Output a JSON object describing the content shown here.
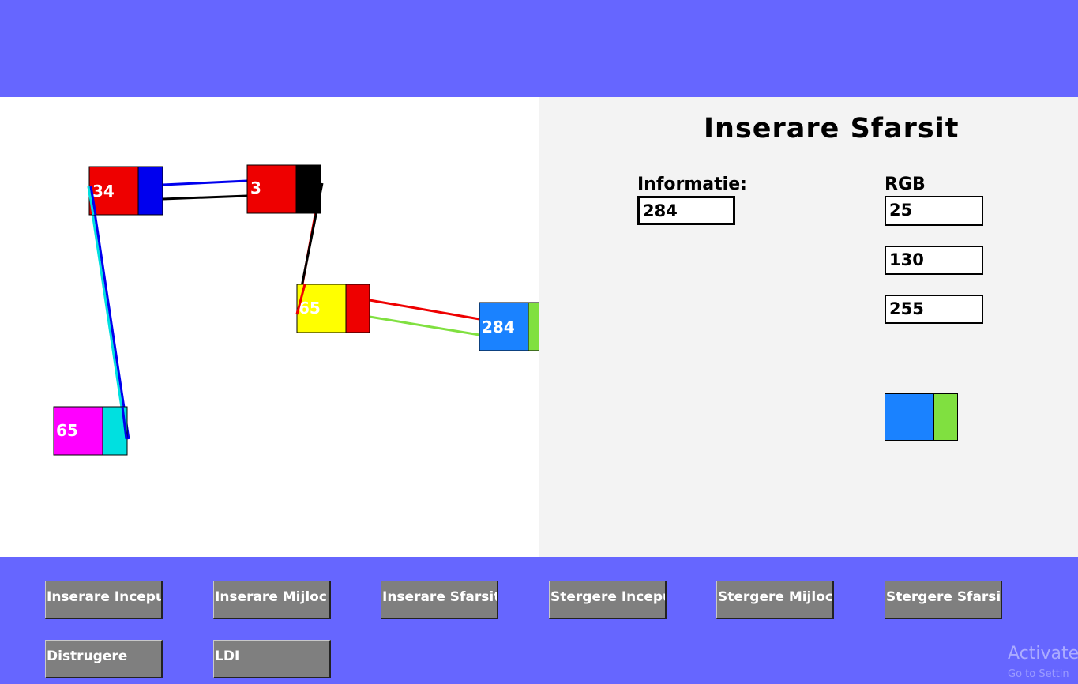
{
  "panel": {
    "title": "Inserare Sfarsit",
    "info_label": "Informatie:",
    "info_value": "284",
    "rgb_label": "RGB",
    "r_value": "25",
    "g_value": "130",
    "b_value": "255",
    "preview_colors": [
      "#1a82ff",
      "#80e040"
    ]
  },
  "nodes": [
    {
      "label": "34",
      "fill": "#ee0000",
      "pointer": "#0000ee"
    },
    {
      "label": "3",
      "fill": "#ee0000",
      "pointer": "#000000"
    },
    {
      "label": "65",
      "fill": "#ffff00",
      "pointer": "#ee0000"
    },
    {
      "label": "284",
      "fill": "#1a82ff",
      "pointer": "#80e040"
    },
    {
      "label": "65",
      "fill": "#ff00ff",
      "pointer": "#00e0e0"
    }
  ],
  "buttons": {
    "inserare_inceput": "Inserare Inceput",
    "inserare_mijloc": "Inserare Mijloc",
    "inserare_sfarsit": "Inserare Sfarsit",
    "stergere_inceput": "Stergere Inceput",
    "stergere_mijloc": "Stergere Mijloc",
    "stergere_sfarsit": "Stergere Sfarsit",
    "distrugere": "Distrugere",
    "ldi": "LDI"
  },
  "watermark": {
    "line1": "Activate",
    "line2": "Go to Settin"
  }
}
